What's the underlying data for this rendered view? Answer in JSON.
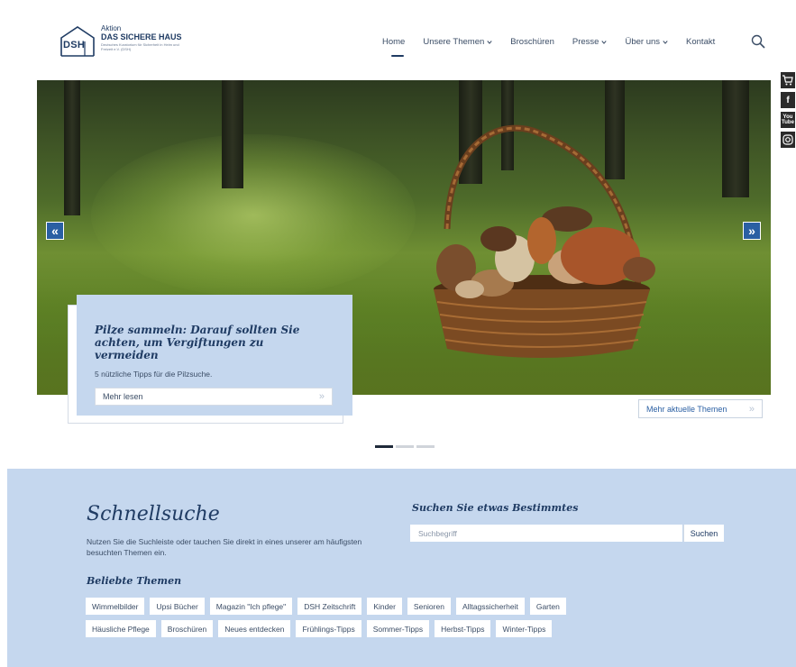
{
  "logo": {
    "mark": "DSH",
    "line1": "Aktion",
    "line2": "DAS SICHERE HAUS",
    "line3": "Deutsches Kuratorium für Sicherheit in Heim und Freizeit e.V. (DSH)"
  },
  "nav": {
    "items": [
      {
        "label": "Home",
        "active": true,
        "dropdown": false
      },
      {
        "label": "Unsere Themen",
        "active": false,
        "dropdown": true
      },
      {
        "label": "Broschüren",
        "active": false,
        "dropdown": false
      },
      {
        "label": "Presse",
        "active": false,
        "dropdown": true
      },
      {
        "label": "Über uns",
        "active": false,
        "dropdown": true
      },
      {
        "label": "Kontakt",
        "active": false,
        "dropdown": false
      }
    ],
    "search_icon": "search-icon"
  },
  "side_icons": [
    "cart-icon",
    "facebook-icon",
    "youtube-icon",
    "instagram-icon"
  ],
  "hero": {
    "prev_arrow": "«",
    "next_arrow": "»",
    "teaser": {
      "title": "Pilze sammeln: Darauf sollten Sie achten, um Vergiftungen zu vermeiden",
      "subtitle": "5 nützliche Tipps für die Pilzsuche.",
      "button_label": "Mehr lesen",
      "button_arrow": "»"
    },
    "more_topics_label": "Mehr aktuelle Themen",
    "more_topics_arrow": "»",
    "slides_total": 3,
    "slide_active": 1
  },
  "quicksearch": {
    "title": "Schnellsuche",
    "description": "Nutzen Sie die Suchleiste oder tauchen Sie direkt in eines unserer am häufigsten besuchten Themen ein.",
    "search_title": "Suchen Sie etwas Bestimmtes",
    "search_placeholder": "Suchbegriff",
    "search_button": "Suchen",
    "popular_title": "Beliebte Themen",
    "tags_row1": [
      "Wimmelbilder",
      "Upsi Bücher",
      "Magazin \"Ich pflege\"",
      "DSH Zeitschrift",
      "Kinder",
      "Senioren",
      "Alltagssicherheit",
      "Garten"
    ],
    "tags_row2": [
      "Häusliche Pflege",
      "Broschüren",
      "Neues entdecken",
      "Frühlings-Tipps",
      "Sommer-Tipps",
      "Herbst-Tipps",
      "Winter-Tipps"
    ]
  },
  "colors": {
    "brand_navy": "#1f3b63",
    "accent_blue": "#2a5fa3",
    "panel_blue": "#c5d7ee"
  }
}
